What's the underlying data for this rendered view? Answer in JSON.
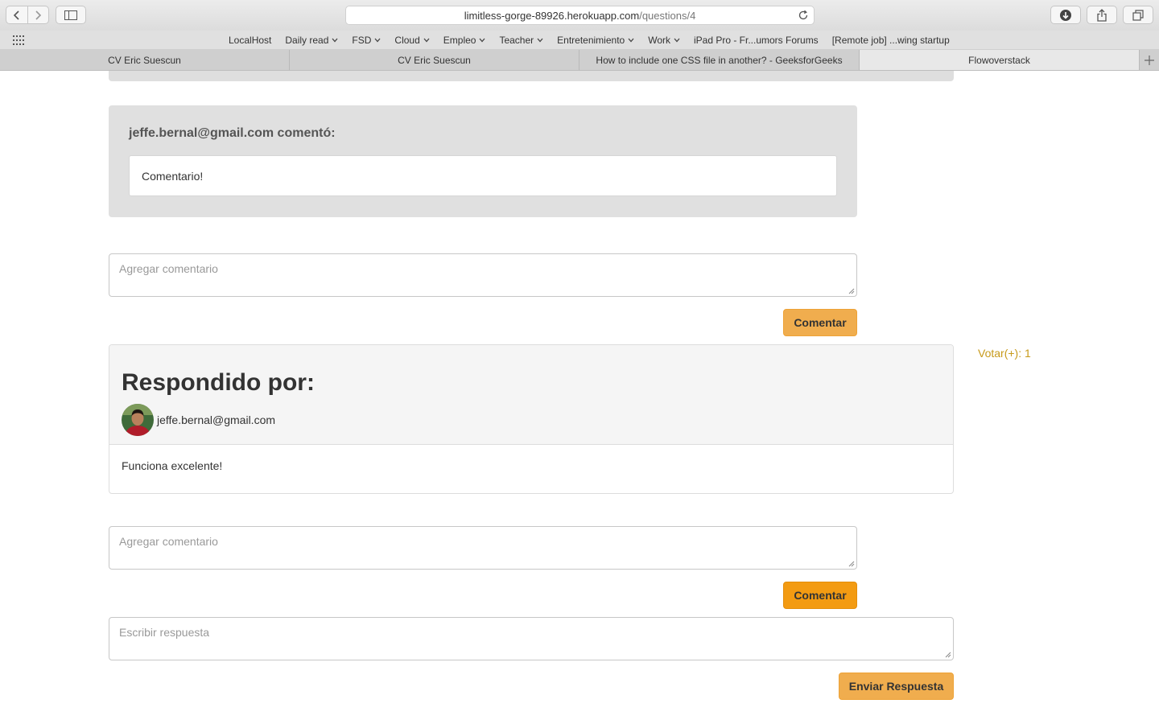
{
  "browser": {
    "url_host": "limitless-gorge-89926.herokuapp.com",
    "url_path": "/questions/4",
    "bookmarks": [
      {
        "label": "LocalHost",
        "has_menu": false
      },
      {
        "label": "Daily read",
        "has_menu": true
      },
      {
        "label": "FSD",
        "has_menu": true
      },
      {
        "label": "Cloud",
        "has_menu": true
      },
      {
        "label": "Empleo",
        "has_menu": true
      },
      {
        "label": "Teacher",
        "has_menu": true
      },
      {
        "label": "Entretenimiento",
        "has_menu": true
      },
      {
        "label": "Work",
        "has_menu": true
      },
      {
        "label": "iPad Pro - Fr...umors Forums",
        "has_menu": false
      },
      {
        "label": "[Remote job] ...wing startup",
        "has_menu": false
      }
    ],
    "tabs": [
      {
        "label": "CV Eric Suescun",
        "active": false
      },
      {
        "label": "CV Eric Suescun",
        "active": false
      },
      {
        "label": "How to include one CSS file in another? - GeeksforGeeks",
        "active": false
      },
      {
        "label": "Flowoverstack",
        "active": true
      }
    ]
  },
  "comment": {
    "author_line": "jeffe.bernal@gmail.com comentó:",
    "body": "Comentario!"
  },
  "comment_form_1": {
    "placeholder": "Agregar comentario",
    "button": "Comentar"
  },
  "answer": {
    "title": "Respondido por:",
    "user": "jeffe.bernal@gmail.com",
    "body": "Funciona excelente!",
    "votes": "Votar(+): 1"
  },
  "comment_form_2": {
    "placeholder": "Agregar comentario",
    "button": "Comentar"
  },
  "answer_form": {
    "placeholder": "Escribir respuesta",
    "button": "Enviar Respuesta"
  },
  "colors": {
    "button_orange": "#f0ad4e",
    "button_orange_active": "#f39b12",
    "vote_text": "#c79a1a"
  }
}
